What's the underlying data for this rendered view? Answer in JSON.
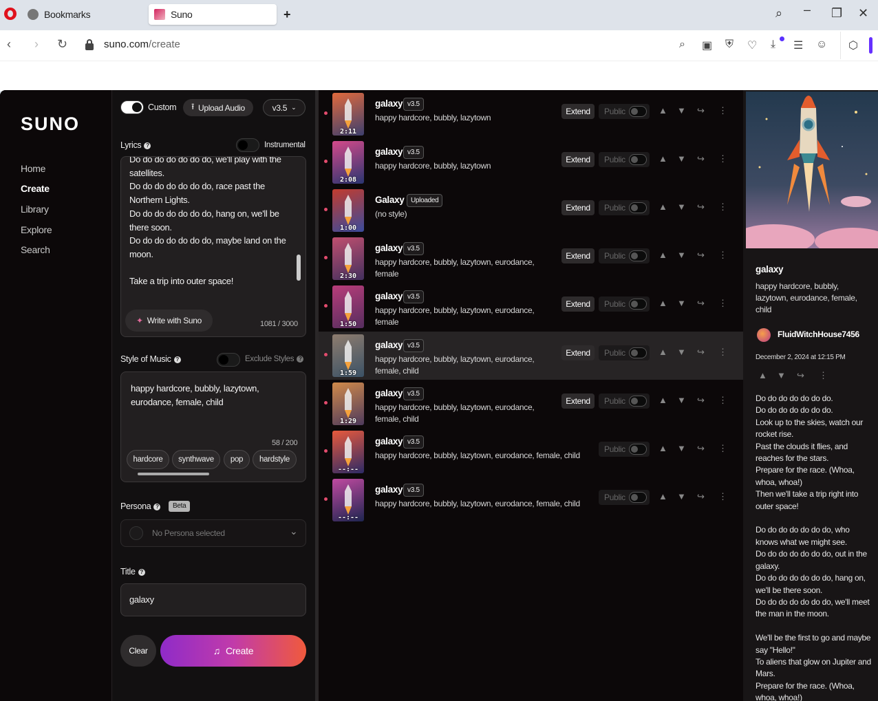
{
  "browser": {
    "tabs": [
      {
        "label": "Bookmarks"
      },
      {
        "label": "Suno"
      }
    ],
    "url_host": "suno.com",
    "url_path": "/create"
  },
  "nav": {
    "logo": "SUNO",
    "items": [
      {
        "label": "Home"
      },
      {
        "label": "Create"
      },
      {
        "label": "Library"
      },
      {
        "label": "Explore"
      },
      {
        "label": "Search"
      }
    ]
  },
  "form": {
    "custom_label": "Custom",
    "upload_label": "Upload Audio",
    "model": "v3.5",
    "lyrics_label": "Lyrics",
    "instrumental_label": "Instrumental",
    "lyrics_text": "Do do do do do do do, we'll play with the satellites.\nDo do do do do do do, race past the Northern Lights.\nDo do do do do do do, hang on, we'll be there soon.\nDo do do do do do do, maybe land on the moon.\n\nTake a trip into outer space!",
    "write_label": "Write with Suno",
    "lyrics_count": "1081 / 3000",
    "style_label": "Style of Music",
    "exclude_label": "Exclude Styles",
    "style_text": "happy hardcore, bubbly, lazytown, eurodance, female, child",
    "style_count": "58 / 200",
    "chips": [
      "hardcore",
      "synthwave",
      "pop",
      "hardstyle"
    ],
    "persona_label": "Persona",
    "beta_label": "Beta",
    "persona_placeholder": "No Persona selected",
    "title_label": "Title",
    "title_value": "galaxy",
    "clear_label": "Clear",
    "create_label": "Create"
  },
  "songs": [
    {
      "title": "galaxy",
      "badge": "v3.5",
      "desc": "happy hardcore, bubbly, lazytown",
      "duration": "2:11",
      "extend": true,
      "colors": [
        "#e06a3d",
        "#3d3f6e"
      ]
    },
    {
      "title": "galaxy",
      "badge": "v3.5",
      "desc": "happy hardcore, bubbly, lazytown",
      "duration": "2:08",
      "extend": true,
      "colors": [
        "#d44a8a",
        "#2a3570"
      ]
    },
    {
      "title": "Galaxy",
      "badge": "Uploaded",
      "desc": "(no style)",
      "duration": "1:00",
      "extend": true,
      "colors": [
        "#c23c2e",
        "#3a4b9c"
      ]
    },
    {
      "title": "galaxy",
      "badge": "v3.5",
      "desc": "happy hardcore, bubbly, lazytown, eurodance, female",
      "duration": "2:30",
      "extend": true,
      "colors": [
        "#c04f6f",
        "#43305e"
      ]
    },
    {
      "title": "galaxy",
      "badge": "v3.5",
      "desc": "happy hardcore, bubbly, lazytown, eurodance, female",
      "duration": "1:50",
      "extend": true,
      "colors": [
        "#b83d7a",
        "#552d5e"
      ]
    },
    {
      "title": "galaxy",
      "badge": "v3.5",
      "desc": "happy hardcore, bubbly, lazytown, eurodance, female, child",
      "duration": "1:59",
      "extend": true,
      "colors": [
        "#8e7c6e",
        "#3b5266"
      ]
    },
    {
      "title": "galaxy",
      "badge": "v3.5",
      "desc": "happy hardcore, bubbly, lazytown, eurodance, female, child",
      "duration": "1:29",
      "extend": true,
      "colors": [
        "#d08a4a",
        "#4e3a5c"
      ]
    },
    {
      "title": "galaxy",
      "badge": "v3.5",
      "desc": "happy hardcore, bubbly, lazytown, eurodance, female, child",
      "duration": "--:--",
      "extend": false,
      "colors": [
        "#e85a3c",
        "#2d2a66"
      ]
    },
    {
      "title": "galaxy",
      "badge": "v3.5",
      "desc": "happy hardcore, bubbly, lazytown, eurodance, female, child",
      "duration": "--:--",
      "extend": false,
      "colors": [
        "#c04aa0",
        "#1e2550"
      ]
    }
  ],
  "list_labels": {
    "extend": "Extend",
    "public": "Public"
  },
  "detail": {
    "title": "galaxy",
    "style": "happy hardcore,  bubbly, lazytown,  eurodance,  female, child",
    "user": "FluidWitchHouse7456",
    "date": "December 2, 2024 at 12:15 PM",
    "lyrics": "Do do do do do do do.\nDo do do do do do do.\nLook up to the skies, watch our rocket rise.\nPast the clouds it flies, and reaches for the stars.\nPrepare for the race. (Whoa, whoa, whoa!)\nThen we'll take a trip right into outer space!\n\nDo do do do do do do, who knows what we might see.\nDo do do do do do do, out in the galaxy.\nDo do do do do do do, hang on, we'll be there soon.\nDo do do do do do do, we'll meet the man in the moon.\n\nWe'll be the first to go and maybe say \"Hello!\"\nTo aliens that glow on Jupiter and Mars.\nPrepare for the race. (Whoa, whoa, whoa!)"
  }
}
